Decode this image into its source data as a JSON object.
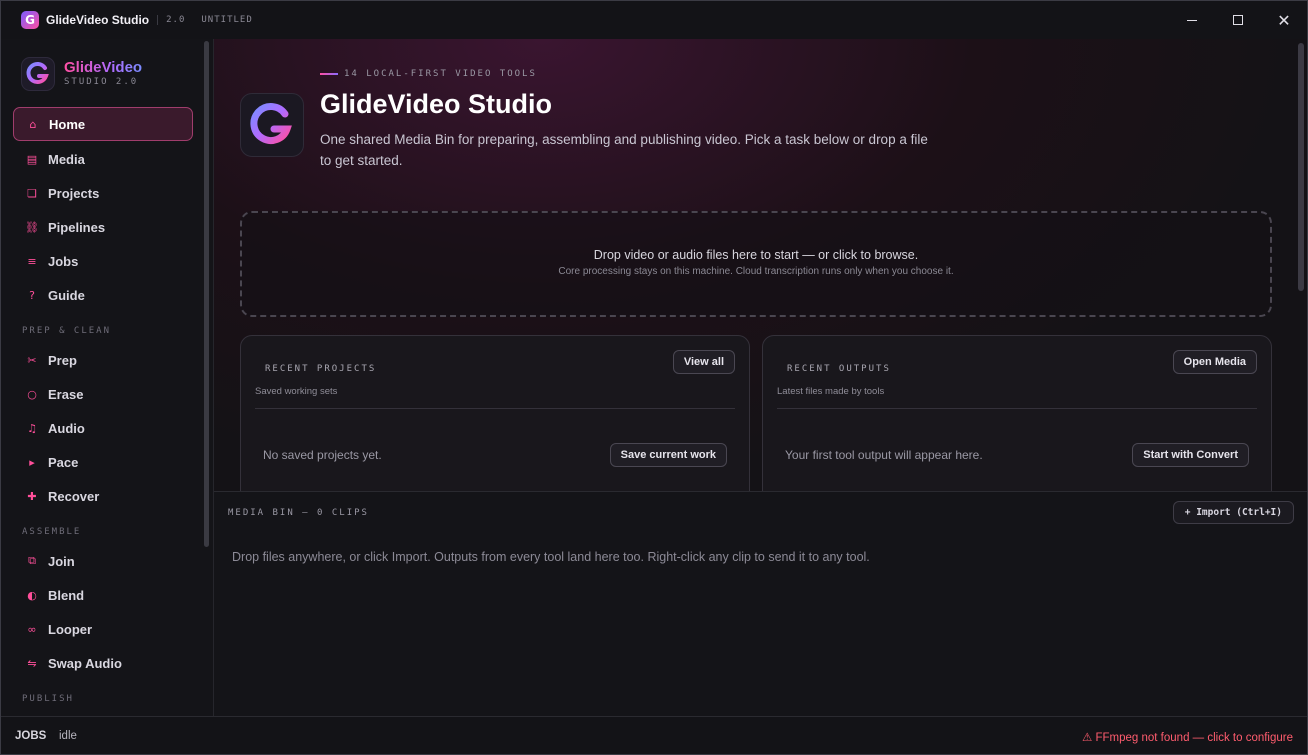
{
  "window": {
    "app_title": "GlideVideo Studio",
    "version": "2.0",
    "document": "UNTITLED",
    "logo_letter": "G"
  },
  "brand": {
    "name": "GlideVideo",
    "subtitle": "STUDIO 2.0"
  },
  "sidebar": {
    "items": [
      {
        "label": "Home",
        "icon": "home-icon",
        "glyph": "⌂",
        "active": true
      },
      {
        "label": "Media",
        "icon": "media-icon",
        "glyph": "▤"
      },
      {
        "label": "Projects",
        "icon": "projects-icon",
        "glyph": "❏"
      },
      {
        "label": "Pipelines",
        "icon": "pipelines-icon",
        "glyph": "⛓"
      },
      {
        "label": "Jobs",
        "icon": "jobs-icon",
        "glyph": "≡"
      },
      {
        "label": "Guide",
        "icon": "guide-icon",
        "glyph": "?"
      }
    ],
    "sections": [
      {
        "title": "PREP & CLEAN",
        "items": [
          {
            "label": "Prep",
            "icon": "scissors-icon",
            "glyph": "✂"
          },
          {
            "label": "Erase",
            "icon": "erase-icon",
            "glyph": "○"
          },
          {
            "label": "Audio",
            "icon": "music-note-icon",
            "glyph": "♫"
          },
          {
            "label": "Pace",
            "icon": "play-icon",
            "glyph": "▸"
          },
          {
            "label": "Recover",
            "icon": "plus-icon",
            "glyph": "✚"
          }
        ]
      },
      {
        "title": "ASSEMBLE",
        "items": [
          {
            "label": "Join",
            "icon": "join-icon",
            "glyph": "⧉"
          },
          {
            "label": "Blend",
            "icon": "blend-icon",
            "glyph": "◐"
          },
          {
            "label": "Looper",
            "icon": "loop-icon",
            "glyph": "∞"
          },
          {
            "label": "Swap Audio",
            "icon": "swap-icon",
            "glyph": "⇋"
          }
        ]
      },
      {
        "title": "PUBLISH",
        "items": []
      }
    ]
  },
  "hero": {
    "eyebrow": "14 LOCAL-FIRST VIDEO TOOLS",
    "title": "GlideVideo Studio",
    "description": "One shared Media Bin for preparing, assembling and publishing video. Pick a task below or drop a file to get started."
  },
  "dropzone": {
    "title": "Drop video or audio files here to start — or click to browse.",
    "subtitle": "Core processing stays on this machine. Cloud transcription runs only when you choose it."
  },
  "recent_projects": {
    "title": "RECENT PROJECTS",
    "subtitle": "Saved working sets",
    "action": "View all",
    "empty": "No saved projects yet.",
    "cta": "Save current work"
  },
  "recent_outputs": {
    "title": "RECENT OUTPUTS",
    "subtitle": "Latest files made by tools",
    "action": "Open Media",
    "empty": "Your first tool output will appear here.",
    "cta": "Start with Convert"
  },
  "media_bin": {
    "title": "MEDIA BIN — 0 CLIPS",
    "import_label": "+ Import (Ctrl+I)",
    "hint": "Drop files anywhere, or click Import. Outputs from every tool land here too. Right-click any clip to send it to any tool."
  },
  "status": {
    "jobs_label": "JOBS",
    "jobs_state": "idle",
    "warning": "⚠ FFmpeg not found — click to configure"
  },
  "colors": {
    "accent": "#ff4fa3",
    "accent_secondary": "#8a6bff",
    "warning": "#ff5c6e"
  }
}
